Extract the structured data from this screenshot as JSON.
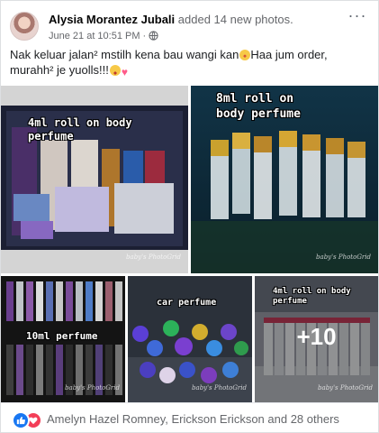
{
  "post": {
    "author": "Alysia Morantez Jubali",
    "action": "added 14 new photos.",
    "date": "June 21 at 10:51 PM",
    "dot": "·",
    "menu": "···",
    "text_line1": "Nak keluar jalan² mstilh kena bau wangi kan",
    "text_line1_after": "Haa jum order,",
    "text_line2": "murahh² je yuolls!!!",
    "emoji": [
      "flushed-face",
      "heart-eyes-face",
      "heart"
    ]
  },
  "photos": [
    {
      "caption": "4ml roll on body\nperfume",
      "watermark": "baby's\nPhotoGrid"
    },
    {
      "caption": "8ml roll on\nbody perfume",
      "watermark": "baby's\nPhotoGrid"
    },
    {
      "caption": "10ml perfume",
      "watermark": "baby's\nPhotoGrid"
    },
    {
      "caption": "car perfume",
      "watermark": "baby's\nPhotoGrid"
    },
    {
      "caption": "4ml roll on body\nperfume",
      "watermark": "baby's\nPhotoGrid",
      "more_label": "+10"
    }
  ],
  "reactions": {
    "icons": [
      "like-icon",
      "love-icon"
    ],
    "summary": "Amelyn Hazel Romney, Erickson Erickson and 28 others"
  },
  "colors": {
    "accent": "#1877f2",
    "love": "#f33e58",
    "meta": "#65676b"
  }
}
